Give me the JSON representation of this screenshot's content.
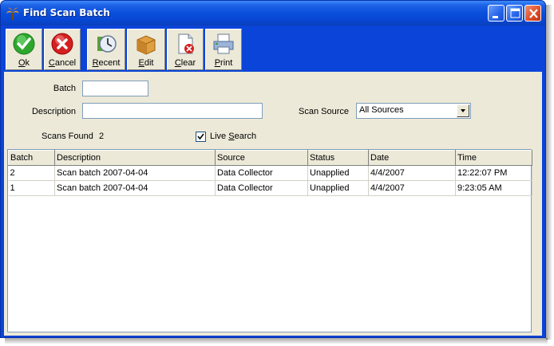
{
  "window": {
    "title": "Find Scan Batch"
  },
  "toolbar": {
    "buttons": [
      {
        "label_ul": "O",
        "label_rest": "k"
      },
      {
        "label_ul": "",
        "label_rest": "Cancel",
        "label_ul2": "C",
        "label_rest2": "ancel"
      },
      {
        "label_ul": "R",
        "label_rest": "ecent"
      },
      {
        "label_ul": "E",
        "label_rest": "dit"
      },
      {
        "label_ul": "C",
        "label_rest": "lear"
      },
      {
        "label_ul": "P",
        "label_rest": "rint"
      }
    ]
  },
  "form": {
    "batch_label": "Batch",
    "batch_value": "",
    "description_label": "Description",
    "description_value": "",
    "scan_source_label": "Scan Source",
    "scan_source_value": "All Sources",
    "scans_found_label": "Scans Found",
    "scans_found_count": "2",
    "live_search_ul": "S",
    "live_search_pre": "Live ",
    "live_search_post": "earch",
    "live_search_checked": true
  },
  "grid": {
    "columns": [
      "Batch",
      "Description",
      "Source",
      "Status",
      "Date",
      "Time"
    ],
    "rows": [
      [
        "2",
        "Scan batch 2007-04-04",
        "Data Collector",
        "Unapplied",
        "4/4/2007",
        "12:22:07 PM"
      ],
      [
        "1",
        "Scan batch 2007-04-04",
        "Data Collector",
        "Unapplied",
        "4/4/2007",
        "9:23:05 AM"
      ]
    ]
  },
  "colors": {
    "titlebar": "#0a4fdc",
    "face": "#ece9d8",
    "ok_green": "#2da82d",
    "cancel_red": "#d42020"
  }
}
